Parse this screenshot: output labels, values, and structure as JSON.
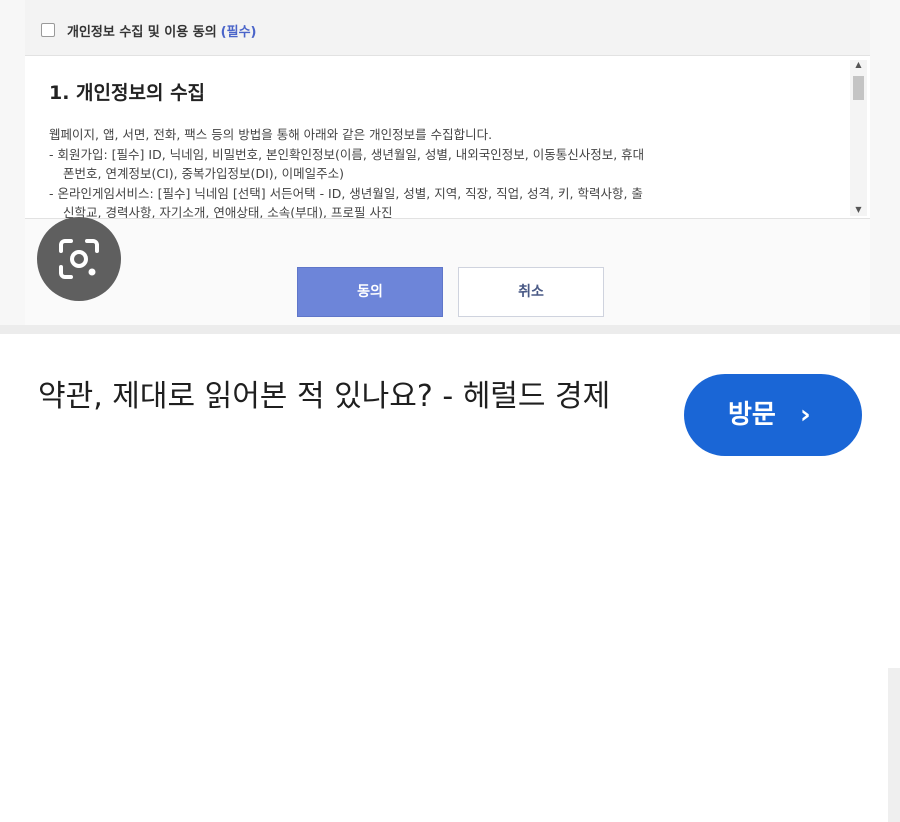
{
  "consent": {
    "title": "개인정보 수집 및 이용 동의",
    "required": "(필수)"
  },
  "terms": {
    "heading": "1. 개인정보의 수집",
    "lines": [
      "웹페이지, 앱, 서면, 전화, 팩스 등의 방법을 통해 아래와 같은 개인정보를 수집합니다.",
      "- 회원가입: [필수] ID, 닉네임, 비밀번호, 본인확인정보(이름, 생년월일, 성별, 내외국인정보, 이동통신사정보, 휴대",
      "폰번호, 연계정보(CI), 중복가입정보(DI), 이메일주소)",
      "- 온라인게임서비스: [필수] 닉네임 [선택] 서든어택 - ID, 생년월일, 성별, 지역, 직장, 직업, 성격, 키, 학력사항, 출",
      "신학교, 경력사항, 자기소개, 연애상태, 소속(부대), 프로필 사진"
    ]
  },
  "buttons": {
    "agree": "동의",
    "cancel": "취소"
  },
  "lens": {
    "icon": "lens-camera-icon"
  },
  "result": {
    "title": "약관, 제대로 읽어본 적 있나요? - 헤럴드 경제",
    "visit_label": "방문",
    "visit_icon": "chevron-right-icon",
    "visit_color": "#1a66d6"
  }
}
